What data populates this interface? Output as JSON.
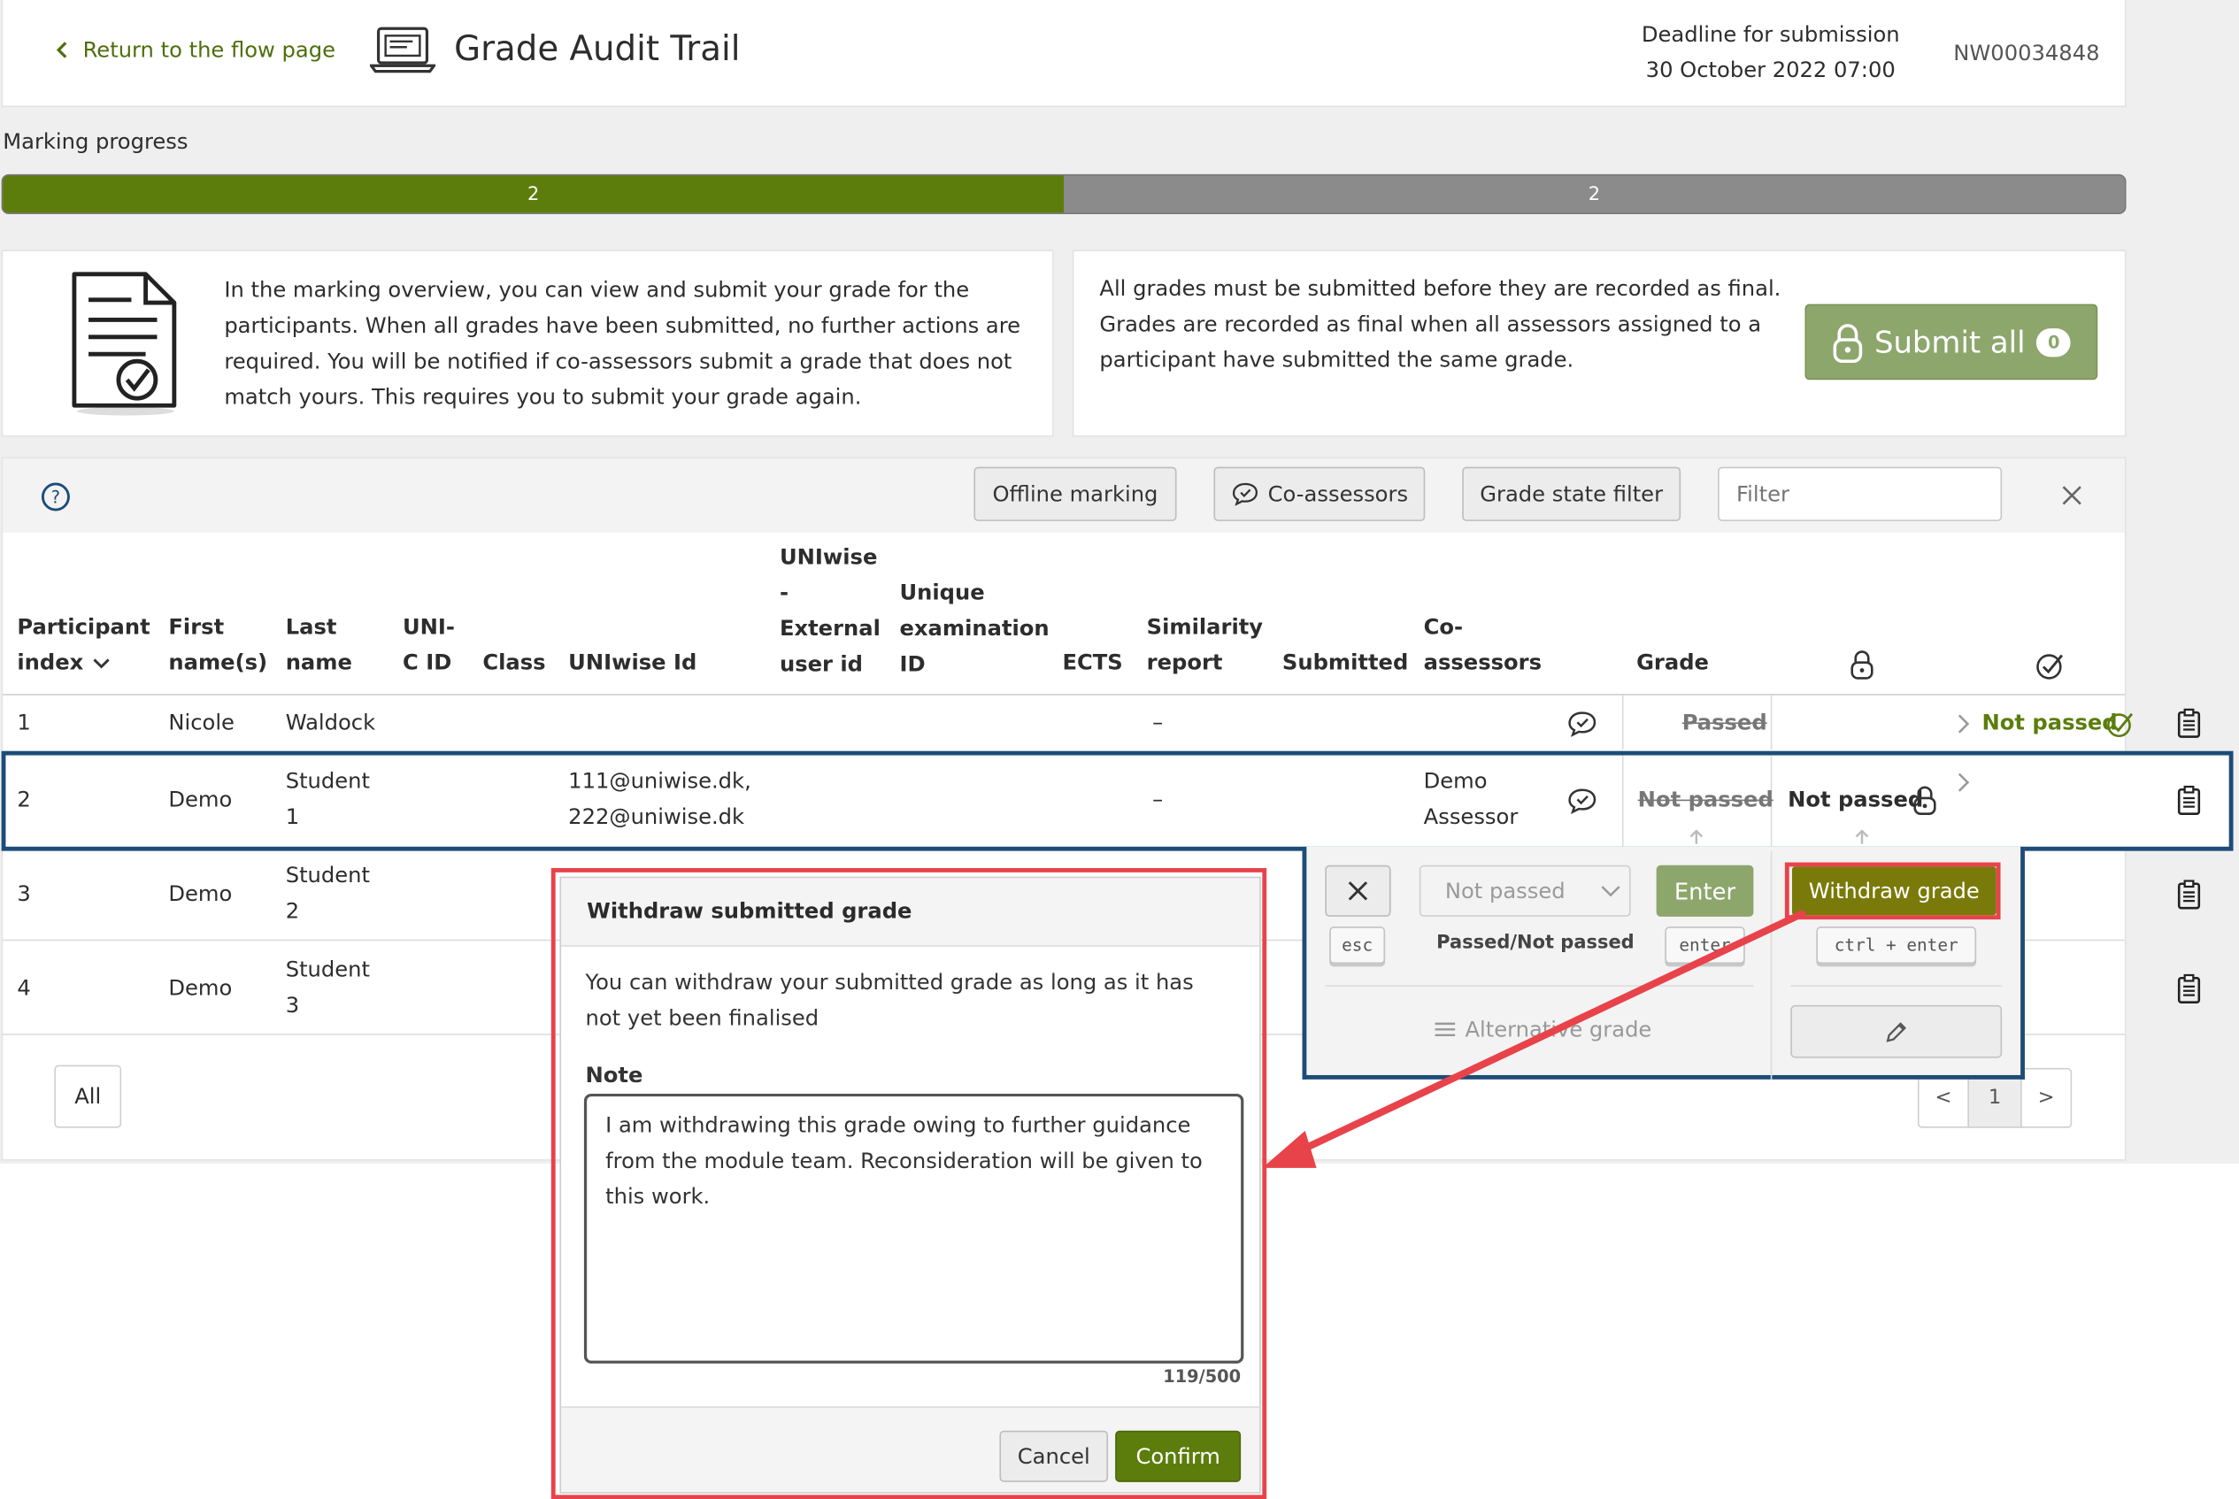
{
  "header": {
    "back_label": "Return to the flow page",
    "title": "Grade Audit Trail",
    "deadline_label": "Deadline for submission",
    "deadline_value": "30 October 2022 07:00",
    "flow_code": "NW00034848"
  },
  "progress": {
    "label": "Marking progress",
    "done_count": "2",
    "remaining_count": "2",
    "done_fraction": 0.5,
    "done_color": "#5c7d0c",
    "remaining_color": "#8b8b8b"
  },
  "info": {
    "overview_text": "In the marking overview, you can view and submit your grade for the participants. When all grades have been submitted, no further actions are required. You will be notified if co-assessors submit a grade that does not match yours. This requires you to submit your grade again.",
    "final_text": "All grades must be submitted before they are recorded as final. Grades are recorded as final when all assessors assigned to a participant have submitted the same grade.",
    "submit_all_label": "Submit all",
    "submit_all_count": "0"
  },
  "toolbar": {
    "help_icon": "question-circle-icon",
    "offline_marking": "Offline marking",
    "co_assessors": "Co-assessors",
    "grade_state_filter": "Grade state filter",
    "filter_placeholder": "Filter"
  },
  "table": {
    "headers": {
      "participant_index_1": "Participant",
      "participant_index_2": "index",
      "first_name_1": "First",
      "first_name_2": "name(s)",
      "last_name_1": "Last",
      "last_name_2": "name",
      "uni_c_id_1": "UNI-",
      "uni_c_id_2": "C ID",
      "class": "Class",
      "uniwise_id": "UNIwise Id",
      "external_1": "UNIwise",
      "external_2": "-",
      "external_3": "External",
      "external_4": "user id",
      "unique_exam_1": "Unique",
      "unique_exam_2": "examination",
      "unique_exam_3": "ID",
      "ects": "ECTS",
      "similarity_1": "Similarity",
      "similarity_2": "report",
      "submitted": "Submitted",
      "co_assessors_1": "Co-",
      "co_assessors_2": "assessors",
      "grade": "Grade"
    },
    "rows": [
      {
        "index": "1",
        "first": "Nicole",
        "last": "Waldock",
        "similarity": "–",
        "co_grade": "Passed",
        "my_grade": "Not passed"
      },
      {
        "index": "2",
        "first": "Demo",
        "last_1": "Student",
        "last_2": "1",
        "uniwise_1": "111@uniwise.dk,",
        "uniwise_2": "222@uniwise.dk",
        "similarity": "–",
        "co_1": "Demo",
        "co_2": "Assessor",
        "co_grade": "Not passed",
        "my_grade": "Not passed"
      },
      {
        "index": "3",
        "first": "Demo",
        "last_1": "Student",
        "last_2": "2"
      },
      {
        "index": "4",
        "first": "Demo",
        "last_1": "Student",
        "last_2": "3"
      }
    ],
    "all_label": "All"
  },
  "grade_panel": {
    "esc_key": "esc",
    "grade_placeholder": "Not passed",
    "scale_label": "Passed/Not passed",
    "enter_label": "Enter",
    "enter_key": "enter",
    "alternative_grade": "Alternative grade",
    "withdraw_label": "Withdraw grade",
    "withdraw_keys": "ctrl + enter"
  },
  "dialog": {
    "title": "Withdraw submitted grade",
    "description": "You can withdraw your submitted grade as long as it has not yet been finalised",
    "note_label": "Note",
    "note_value": "I am withdrawing this grade owing to further guidance from the module team. Reconsideration will be given to this work.",
    "char_count": "119/500",
    "cancel_label": "Cancel",
    "confirm_label": "Confirm"
  },
  "pagination": {
    "prev": "<",
    "current": "1",
    "next": ">"
  },
  "colors": {
    "accent_green": "#5c7d0c",
    "highlight_blue": "#1d4c78",
    "annotation_red": "#e8434a"
  }
}
